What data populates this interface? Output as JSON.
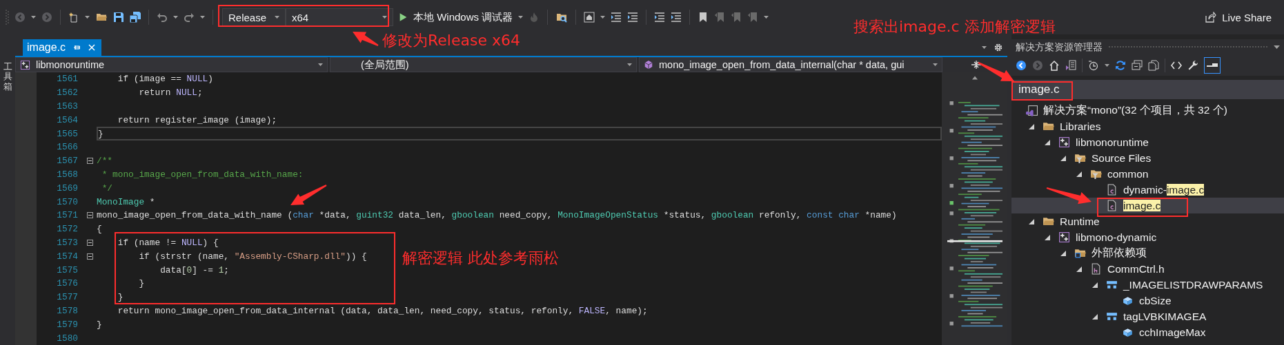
{
  "toolbar": {
    "configuration": "Release",
    "platform": "x64",
    "debugger": "本地 Windows 调试器",
    "live_share": "Live Share"
  },
  "toolbox_strip": {
    "label": "工具箱"
  },
  "editor": {
    "tabs": [
      {
        "label": "image.c",
        "selected": true
      }
    ],
    "navigation": {
      "project": "libmonoruntime",
      "scope": "(全局范围)",
      "member": "mono_image_open_from_data_internal(char * data, gui"
    },
    "lines": [
      {
        "number": "1561",
        "fold": false,
        "current": false,
        "tokens": [
          {
            "kind": "plain",
            "text": "    if ("
          },
          {
            "kind": "plain",
            "text": "image"
          },
          {
            "kind": "plain",
            "text": " == "
          },
          {
            "kind": "macro",
            "text": "NULL"
          },
          {
            "kind": "plain",
            "text": ")"
          }
        ]
      },
      {
        "number": "1562",
        "fold": false,
        "current": false,
        "tokens": [
          {
            "kind": "plain",
            "text": "        return "
          },
          {
            "kind": "macro",
            "text": "NULL"
          },
          {
            "kind": "plain",
            "text": ";"
          }
        ]
      },
      {
        "number": "1563",
        "fold": false,
        "current": false
      },
      {
        "number": "1564",
        "fold": false,
        "current": false,
        "tokens": [
          {
            "kind": "plain",
            "text": "    return register_image (image);"
          }
        ]
      },
      {
        "number": "1565",
        "fold": false,
        "current": true,
        "tokens": [
          {
            "kind": "plain",
            "text": "}"
          }
        ]
      },
      {
        "number": "1566",
        "fold": false,
        "current": false
      },
      {
        "number": "1567",
        "fold": true,
        "current": false,
        "tokens": [
          {
            "kind": "comment",
            "text": "/**"
          }
        ]
      },
      {
        "number": "1568",
        "fold": false,
        "current": false,
        "tokens": [
          {
            "kind": "comment",
            "text": " * mono_image_open_from_data_with_name:"
          }
        ]
      },
      {
        "number": "1569",
        "fold": false,
        "current": false,
        "tokens": [
          {
            "kind": "comment",
            "text": " */"
          }
        ]
      },
      {
        "number": "1570",
        "fold": false,
        "current": false,
        "tokens": [
          {
            "kind": "type",
            "text": "MonoImage"
          },
          {
            "kind": "plain",
            "text": " *"
          }
        ]
      },
      {
        "number": "1571",
        "fold": true,
        "current": false,
        "tokens": [
          {
            "kind": "plain",
            "text": "mono_image_open_from_data_with_name ("
          },
          {
            "kind": "keyword",
            "text": "char"
          },
          {
            "kind": "plain",
            "text": " *data, "
          },
          {
            "kind": "type",
            "text": "guint32"
          },
          {
            "kind": "plain",
            "text": " data_len, "
          },
          {
            "kind": "type",
            "text": "gboolean"
          },
          {
            "kind": "plain",
            "text": " need_copy, "
          },
          {
            "kind": "type",
            "text": "MonoImageOpenStatus"
          },
          {
            "kind": "plain",
            "text": " *status, "
          },
          {
            "kind": "type",
            "text": "gboolean"
          },
          {
            "kind": "plain",
            "text": " refonly, "
          },
          {
            "kind": "keyword",
            "text": "const char"
          },
          {
            "kind": "plain",
            "text": " *name)"
          }
        ]
      },
      {
        "number": "1572",
        "fold": false,
        "current": false,
        "tokens": [
          {
            "kind": "plain",
            "text": "{"
          }
        ]
      },
      {
        "number": "1573",
        "fold": true,
        "current": false,
        "tokens": [
          {
            "kind": "plain",
            "text": "    if (name != "
          },
          {
            "kind": "macro",
            "text": "NULL"
          },
          {
            "kind": "plain",
            "text": ") {"
          }
        ]
      },
      {
        "number": "1574",
        "fold": true,
        "current": false,
        "tokens": [
          {
            "kind": "plain",
            "text": "        if (strstr (name, "
          },
          {
            "kind": "string",
            "text": "\"Assembly-CSharp.dll\""
          },
          {
            "kind": "plain",
            "text": ")) {"
          }
        ]
      },
      {
        "number": "1575",
        "fold": false,
        "current": false,
        "tokens": [
          {
            "kind": "plain",
            "text": "            data["
          },
          {
            "kind": "number",
            "text": "0"
          },
          {
            "kind": "plain",
            "text": "] -= "
          },
          {
            "kind": "number",
            "text": "1"
          },
          {
            "kind": "plain",
            "text": ";"
          }
        ]
      },
      {
        "number": "1576",
        "fold": false,
        "current": false,
        "tokens": [
          {
            "kind": "plain",
            "text": "        }"
          }
        ]
      },
      {
        "number": "1577",
        "fold": false,
        "current": false,
        "tokens": [
          {
            "kind": "plain",
            "text": "    }"
          }
        ]
      },
      {
        "number": "1578",
        "fold": false,
        "current": false,
        "tokens": [
          {
            "kind": "plain",
            "text": "    return mono_image_open_from_data_internal (data, data_len, need_copy, status, refonly, "
          },
          {
            "kind": "macro",
            "text": "FALSE"
          },
          {
            "kind": "plain",
            "text": ", name);"
          }
        ]
      },
      {
        "number": "1579",
        "fold": false,
        "current": false,
        "tokens": [
          {
            "kind": "plain",
            "text": "}"
          }
        ]
      },
      {
        "number": "1580",
        "fold": false,
        "current": false
      }
    ]
  },
  "solution_explorer": {
    "title": "解决方案资源管理器",
    "search": {
      "value": "image.c"
    },
    "tree": [
      {
        "kind": "solution",
        "label": "解决方案“mono”(32 个项目，共 32 个)",
        "selected": false,
        "children": [
          {
            "kind": "folder",
            "label": "Libraries",
            "expanded": true,
            "selected": false,
            "children": [
              {
                "kind": "project",
                "label": "libmonoruntime",
                "expanded": true,
                "selected": false,
                "children": [
                  {
                    "kind": "filter",
                    "label": "Source Files",
                    "expanded": true,
                    "selected": false,
                    "children": [
                      {
                        "kind": "filter",
                        "label": "common",
                        "expanded": true,
                        "selected": false,
                        "children": [
                          {
                            "kind": "c-file",
                            "label": "dynamic-",
                            "match": "image.c",
                            "selected": false
                          },
                          {
                            "kind": "c-file",
                            "match": "image.c",
                            "selected": true
                          }
                        ]
                      }
                    ]
                  }
                ]
              }
            ]
          },
          {
            "kind": "folder",
            "label": "Runtime",
            "expanded": true,
            "selected": false,
            "children": [
              {
                "kind": "project",
                "label": "libmono-dynamic",
                "expanded": true,
                "selected": false,
                "children": [
                  {
                    "kind": "dependencies",
                    "label": "外部依赖项",
                    "expanded": true,
                    "selected": false,
                    "children": [
                      {
                        "kind": "h-file",
                        "label": "CommCtrl.h",
                        "expanded": true,
                        "selected": false,
                        "children": [
                          {
                            "kind": "struct",
                            "label": "_IMAGELISTDRAWPARAMS",
                            "expanded": true,
                            "selected": false,
                            "children": [
                              {
                                "kind": "field",
                                "label": "cbSize",
                                "selected": false
                              }
                            ]
                          },
                          {
                            "kind": "struct",
                            "label": "tagLVBKIMAGEA",
                            "expanded": true,
                            "selected": false,
                            "children": [
                              {
                                "kind": "field",
                                "label": "cchImageMax",
                                "selected": false
                              }
                            ]
                          }
                        ]
                      }
                    ]
                  }
                ]
              }
            ]
          }
        ]
      }
    ]
  },
  "annotations": [
    {
      "kind": "box"
    },
    {
      "kind": "arrow"
    },
    {
      "kind": "note",
      "text": "修改为Release x64"
    },
    {
      "kind": "note",
      "text": "搜索出image.c 添加解密逻辑"
    },
    {
      "kind": "arrow"
    },
    {
      "kind": "box"
    },
    {
      "kind": "arrow"
    },
    {
      "kind": "box"
    },
    {
      "kind": "arrow"
    },
    {
      "kind": "box"
    },
    {
      "kind": "note",
      "text": "解密逻辑 此处参考雨松"
    }
  ]
}
